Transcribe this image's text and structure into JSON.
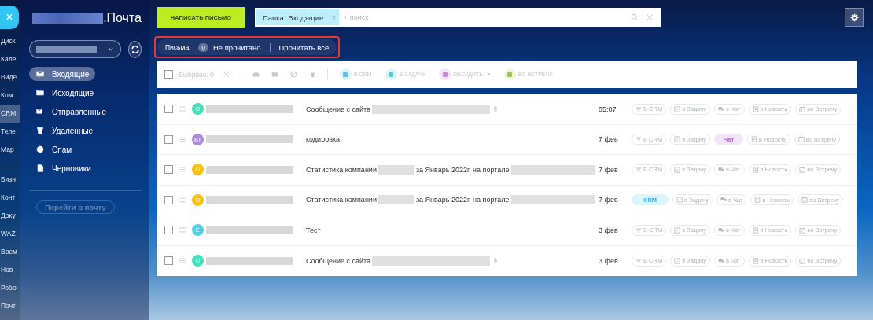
{
  "rail": {
    "close": "×",
    "items": [
      {
        "label": "Диск",
        "selected": false
      },
      {
        "label": "Кале",
        "selected": false
      },
      {
        "label": "Виде",
        "selected": false
      },
      {
        "label": "Ком",
        "selected": false
      },
      {
        "label": "CRM",
        "selected": true
      },
      {
        "label": "Теле",
        "selected": false
      },
      {
        "label": "Мар",
        "selected": false
      }
    ],
    "items_2": [
      {
        "label": "Бизн",
        "selected": false
      },
      {
        "label": "Конт",
        "selected": false
      },
      {
        "label": "Доку",
        "selected": false
      },
      {
        "label": "WAZ",
        "selected": false
      },
      {
        "label": "Врем",
        "selected": false
      },
      {
        "label": "Нов",
        "selected": false
      },
      {
        "label": "Робо",
        "selected": false
      },
      {
        "label": "Почт",
        "selected": false
      }
    ]
  },
  "sidebar": {
    "title": ".Почта",
    "folders": [
      {
        "kind": "inbox",
        "label": "Входящие",
        "selected": true
      },
      {
        "kind": "outbox",
        "label": "Исходящие",
        "selected": false
      },
      {
        "kind": "sent",
        "label": "Отправленные",
        "selected": false
      },
      {
        "kind": "trash",
        "label": "Удаленные",
        "selected": false
      },
      {
        "kind": "spam",
        "label": "Спам",
        "selected": false
      },
      {
        "kind": "drafts",
        "label": "Черновики",
        "selected": false
      }
    ],
    "go_button": {
      "label": "Перейти в почту",
      "disabled": true
    }
  },
  "header": {
    "compose": "НАПИСАТЬ ПИСЬМО",
    "filter_tag": "Папка: Входящие",
    "tag_remove": "×",
    "search": {
      "placeholder": "+ поиск"
    }
  },
  "counter": {
    "label": "Письма:",
    "count": "0",
    "unread": "Не прочитано",
    "read_all": "Прочитать всё"
  },
  "toolbar": {
    "checked": false,
    "selected": "Выбрано: 0",
    "actions": [
      {
        "kind": "crm",
        "label": "В CRM",
        "disabled": true
      },
      {
        "kind": "task",
        "label": "В ЗАДАЧУ",
        "disabled": true
      },
      {
        "kind": "discuss",
        "label": "ОБСУДИТЬ",
        "disabled": true
      },
      {
        "kind": "meeting",
        "label": "ВО ВСТРЕЧУ",
        "disabled": true
      }
    ]
  },
  "rows": [
    {
      "checked": false,
      "initials": "О",
      "color": "#45e0b8",
      "subject": [
        "Сообщение с сайта"
      ],
      "redacted": true,
      "attachment": true,
      "date": "05:07",
      "actions": [
        {
          "kind": "crm",
          "label": "В CRM",
          "done": false
        },
        {
          "kind": "task",
          "label": "в Задачу",
          "done": false
        },
        {
          "kind": "chat",
          "label": "в Чат",
          "done": false
        },
        {
          "kind": "news",
          "label": "в Новость",
          "done": false
        },
        {
          "kind": "meeting",
          "label": "во Встречу",
          "done": false
        }
      ]
    },
    {
      "checked": false,
      "initials": "ВТ",
      "color": "#a98bdc",
      "subject": [
        "кодировка"
      ],
      "redacted": false,
      "attachment": false,
      "date": "7 фев",
      "actions": [
        {
          "kind": "crm",
          "label": "В CRM",
          "done": false
        },
        {
          "kind": "task",
          "label": "в Задачу",
          "done": false
        },
        {
          "kind": "chat",
          "label": "Чат",
          "done": true
        },
        {
          "kind": "news",
          "label": "в Новость",
          "done": false
        },
        {
          "kind": "meeting",
          "label": "во Встречу",
          "done": false
        }
      ]
    },
    {
      "checked": false,
      "initials": "О",
      "color": "#ffbf10",
      "subject": [
        "Статистика компании",
        "за Январь 2022г. на портале"
      ],
      "redacted": true,
      "attachment": false,
      "date": "7 фев",
      "actions": [
        {
          "kind": "crm",
          "label": "В CRM",
          "done": false
        },
        {
          "kind": "task",
          "label": "в Задачу",
          "done": false
        },
        {
          "kind": "chat",
          "label": "в Чат",
          "done": false
        },
        {
          "kind": "news",
          "label": "в Новость",
          "done": false
        },
        {
          "kind": "meeting",
          "label": "во Встречу",
          "done": false
        }
      ]
    },
    {
      "checked": false,
      "initials": "О",
      "color": "#ffbf10",
      "subject": [
        "Статистика компании",
        "за Январь 2022г. на портале"
      ],
      "redacted": true,
      "attachment": false,
      "date": "7 фев",
      "actions": [
        {
          "kind": "crm",
          "label": "CRM",
          "done": true
        },
        {
          "kind": "task",
          "label": "в Задачу",
          "done": false
        },
        {
          "kind": "chat",
          "label": "в Чат",
          "done": false
        },
        {
          "kind": "news",
          "label": "в Новость",
          "done": false
        },
        {
          "kind": "meeting",
          "label": "во Встречу",
          "done": false
        }
      ]
    },
    {
      "checked": false,
      "initials": "Е",
      "color": "#4fd0e3",
      "subject": [
        "Тест"
      ],
      "redacted": false,
      "attachment": false,
      "date": "3 фев",
      "actions": [
        {
          "kind": "crm",
          "label": "В CRM",
          "done": false
        },
        {
          "kind": "task",
          "label": "в Задачу",
          "done": false
        },
        {
          "kind": "chat",
          "label": "в Чат",
          "done": false
        },
        {
          "kind": "news",
          "label": "в Новость",
          "done": false
        },
        {
          "kind": "meeting",
          "label": "во Встречу",
          "done": false
        }
      ]
    },
    {
      "checked": false,
      "initials": "О",
      "color": "#45e0b8",
      "subject": [
        "Сообщение с сайта"
      ],
      "redacted": true,
      "attachment": true,
      "date": "3 фев",
      "actions": [
        {
          "kind": "crm",
          "label": "В CRM",
          "done": false
        },
        {
          "kind": "task",
          "label": "в Задачу",
          "done": false
        },
        {
          "kind": "chat",
          "label": "в Чат",
          "done": false
        },
        {
          "kind": "news",
          "label": "в Новость",
          "done": false
        },
        {
          "kind": "meeting",
          "label": "во Встречу",
          "done": false
        }
      ]
    }
  ]
}
